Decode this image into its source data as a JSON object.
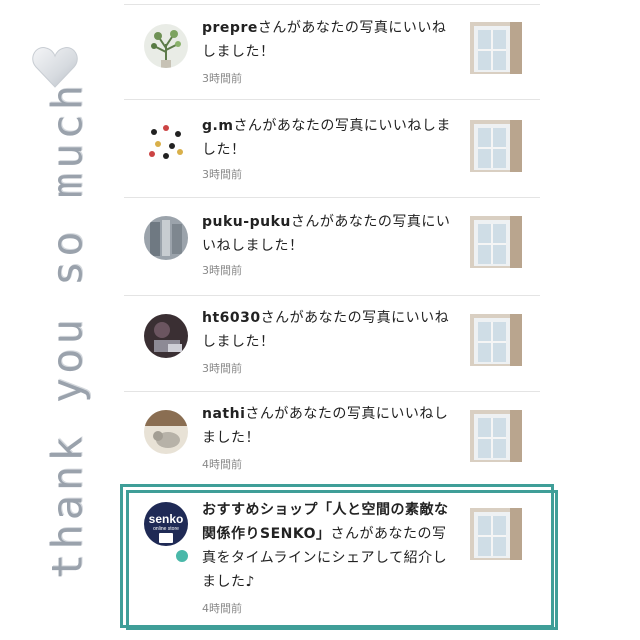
{
  "decoration": {
    "side_text": "thank you so much",
    "heart_icon": "heart-icon"
  },
  "notifications": [
    {
      "user": "prepre",
      "text": "さんがあなたの写真にいいねしました！",
      "time": "3時間前"
    },
    {
      "user": "g.m",
      "text": "さんがあなたの写真にいいねしました！",
      "time": "3時間前"
    },
    {
      "user": "puku-puku",
      "text": "さんがあなたの写真にいいねしました！",
      "time": "3時間前"
    },
    {
      "user": "ht6030",
      "text": "さんがあなたの写真にいいねしました！",
      "time": "3時間前"
    },
    {
      "user": "nathi",
      "text": "さんがあなたの写真にいいねしました！",
      "time": "4時間前"
    },
    {
      "user": "おすすめショップ「人と空間の素敵な関係作りSENKO」",
      "text": "さんがあなたの写真をタイムラインにシェアして紹介しました♪",
      "time": "4時間前",
      "avatar_text": "senko",
      "avatar_subtext": "online store"
    }
  ],
  "colors": {
    "frame": "#3f9e98",
    "badge": "#4ab8a9",
    "side_text": "#9aa2ac"
  }
}
